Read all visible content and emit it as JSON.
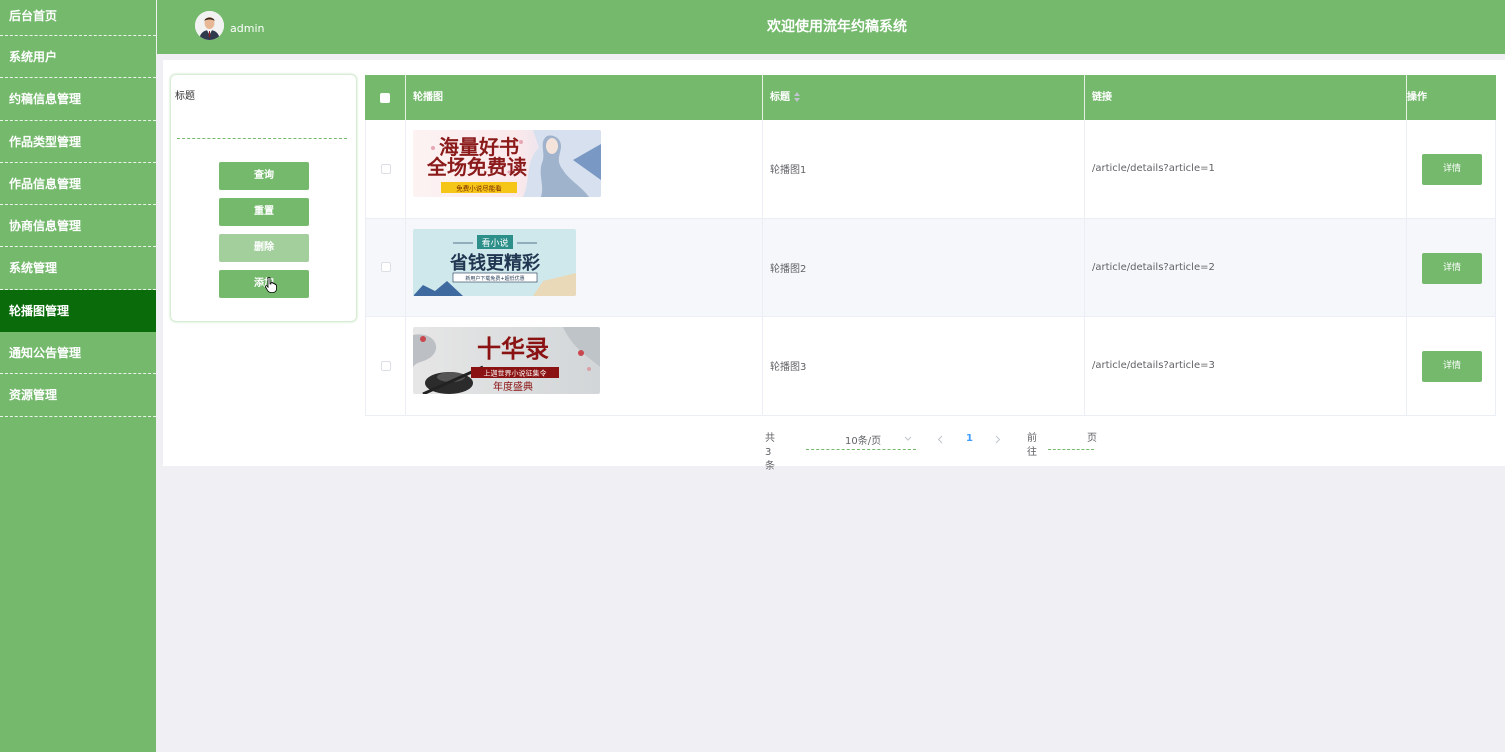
{
  "sidebar": {
    "items": [
      {
        "label": "后台首页"
      },
      {
        "label": "系统用户"
      },
      {
        "label": "约稿信息管理"
      },
      {
        "label": "作品类型管理"
      },
      {
        "label": "作品信息管理"
      },
      {
        "label": "协商信息管理"
      },
      {
        "label": "系统管理"
      },
      {
        "label": "轮播图管理"
      },
      {
        "label": "通知公告管理"
      },
      {
        "label": "资源管理"
      }
    ]
  },
  "header": {
    "user": "admin",
    "title": "欢迎使用流年约稿系统"
  },
  "search": {
    "label": "标题",
    "value": "",
    "buttons": {
      "query": "查询",
      "reset": "重置",
      "delete": "删除",
      "add": "添加"
    }
  },
  "table": {
    "columns": {
      "image": "轮播图",
      "title": "标题",
      "link": "链接",
      "op": "操作"
    },
    "rows": [
      {
        "title": "轮播图1",
        "link": "/article/details?article=1",
        "action": "详情",
        "banner": {
          "line1": "海量好书",
          "line2": "全场免费读",
          "tag": "免费小说尽能看"
        }
      },
      {
        "title": "轮播图2",
        "link": "/article/details?article=2",
        "action": "详情",
        "banner": {
          "badge": "看小说",
          "line1": "省钱更精彩",
          "tag": "新用户下载免费+超低优惠"
        }
      },
      {
        "title": "轮播图3",
        "link": "/article/details?article=3",
        "action": "详情",
        "banner": {
          "line1": "十华录",
          "tag": "上迦世界小说征集令",
          "line2": "年度盛典"
        }
      }
    ]
  },
  "pagination": {
    "total": "共 3 条",
    "page_size": "10条/页",
    "current": "1",
    "goto_prefix": "前往",
    "goto_suffix": "页"
  },
  "colors": {
    "primary": "#74b96c",
    "active": "#0a6b0a",
    "page_bg": "#efeff4"
  }
}
